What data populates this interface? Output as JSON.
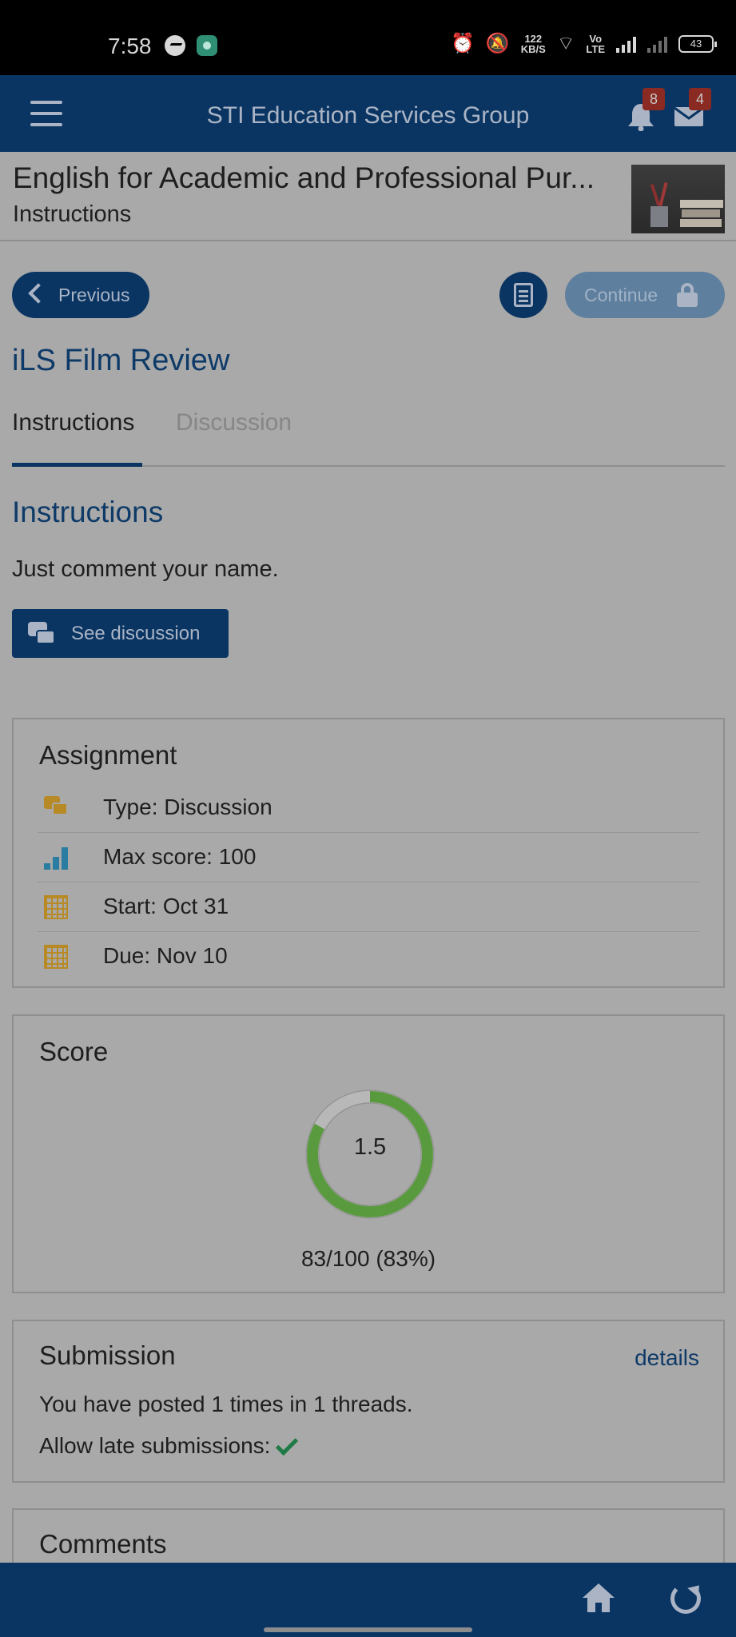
{
  "status_bar": {
    "time": "7:58",
    "network_speed_value": "122",
    "network_speed_unit": "KB/S",
    "volte_top": "Vo",
    "volte_bottom": "LTE",
    "battery": "43",
    "icons": [
      "messenger-icon",
      "app-icon",
      "alarm-icon",
      "mute-icon",
      "wifi-icon",
      "signal-icon",
      "battery-icon"
    ]
  },
  "header": {
    "title": "STI Education Services Group",
    "notifications_count": "8",
    "messages_count": "4",
    "colors": {
      "bar": "#0a3563",
      "badge": "#8a2a22"
    }
  },
  "course": {
    "title": "English for Academic and Professional Pur...",
    "subtitle": "Instructions"
  },
  "nav": {
    "previous_label": "Previous",
    "continue_label": "Continue"
  },
  "page": {
    "heading": "iLS Film Review",
    "tabs": [
      {
        "label": "Instructions",
        "active": true
      },
      {
        "label": "Discussion",
        "active": false
      }
    ]
  },
  "instructions": {
    "heading": "Instructions",
    "text": "Just comment your name.",
    "see_discussion_label": "See discussion"
  },
  "assignment": {
    "title": "Assignment",
    "rows": [
      {
        "icon": "discussion-icon",
        "text": "Type: Discussion"
      },
      {
        "icon": "bar-chart-icon",
        "text": "Max score: 100"
      },
      {
        "icon": "calendar-icon",
        "text": "Start: Oct 31"
      },
      {
        "icon": "calendar-icon",
        "text": "Due: Nov 10"
      }
    ]
  },
  "score": {
    "title": "Score",
    "center_value": "1.5",
    "detail": "83/100 (83%)",
    "fraction": 0.83,
    "colors": {
      "filled": "#5a9a3e",
      "remaining": "#b8b8b8"
    }
  },
  "submission": {
    "title": "Submission",
    "details_link": "details",
    "posted_text": "You have posted 1 times in 1 threads.",
    "late_text": "Allow late submissions:"
  },
  "comments": {
    "title": "Comments"
  }
}
